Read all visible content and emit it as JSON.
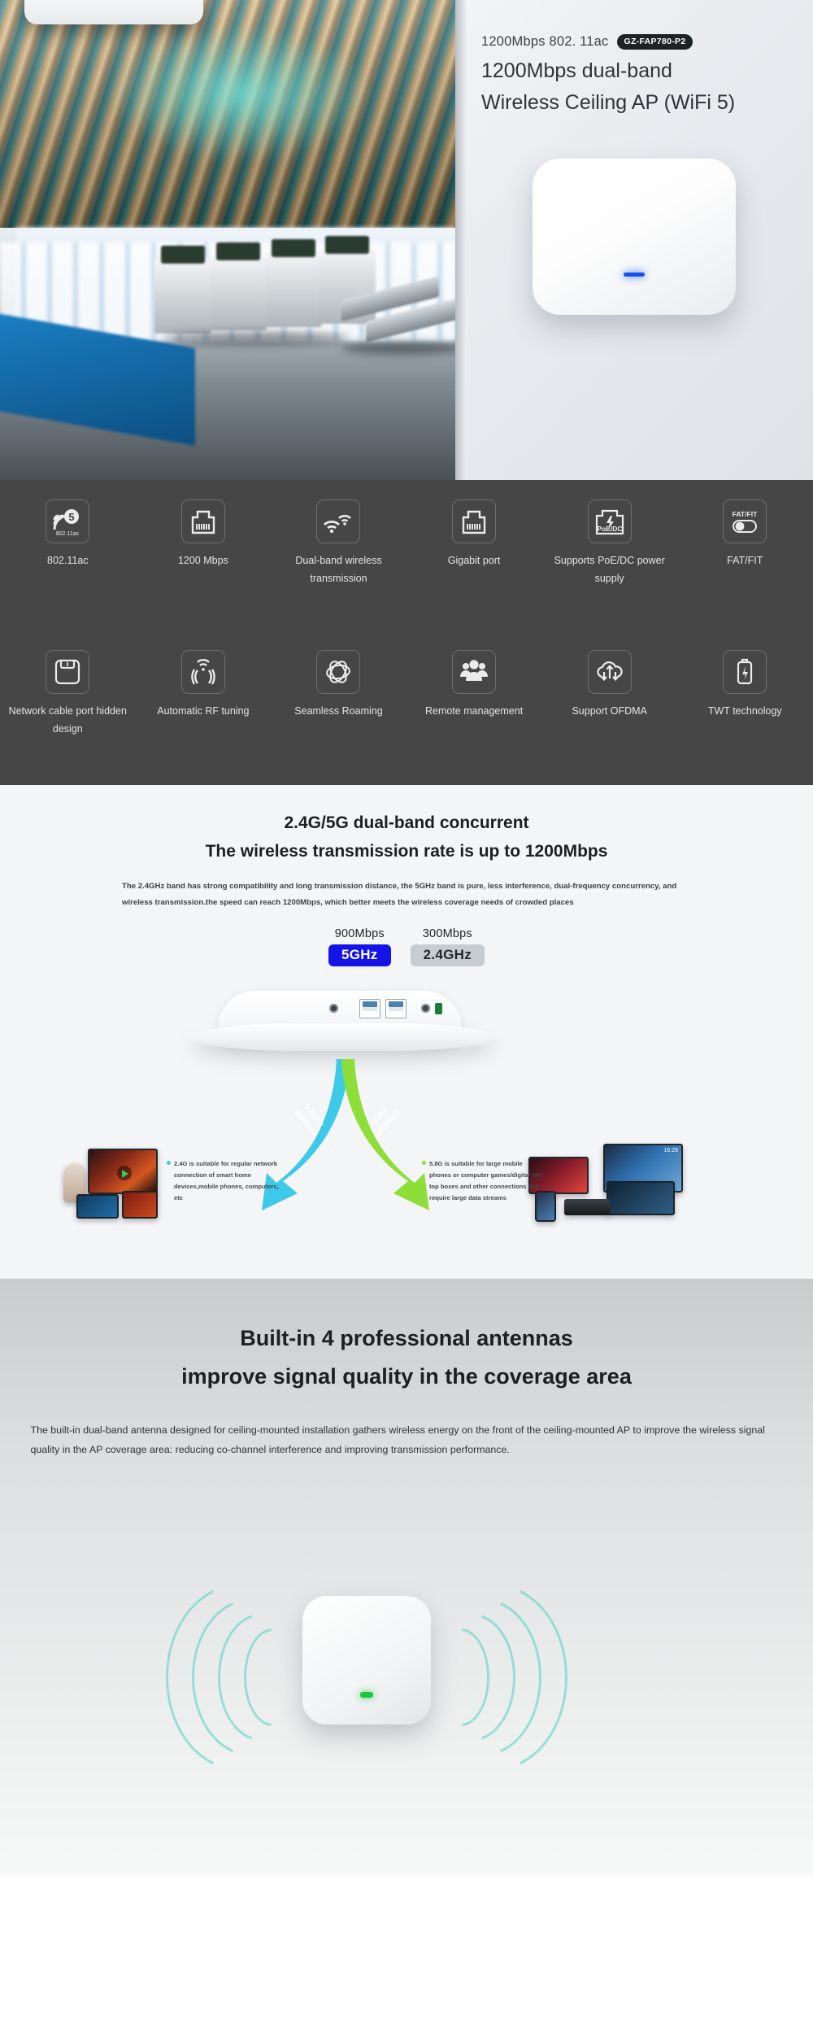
{
  "hero": {
    "kicker": "1200Mbps 802. 11ac",
    "sku": "GZ-FAP780-P2",
    "title_line1": "1200Mbps dual-band",
    "title_line2": "Wireless Ceiling AP (WiFi 5)"
  },
  "features": {
    "row1": [
      {
        "label": "802.11ac",
        "icon": "wifi5-802-11ac-icon",
        "icon_text": "5",
        "icon_sub": "802.11ac"
      },
      {
        "label": "1200 Mbps",
        "icon": "rj45-port-icon"
      },
      {
        "label": "Dual-band wireless transmission",
        "icon": "dual-wifi-icon"
      },
      {
        "label": "Gigabit port",
        "icon": "rj45-port-icon"
      },
      {
        "label": "Supports PoE/DC power supply",
        "icon": "poe-dc-icon",
        "icon_text": "PoE/DC"
      },
      {
        "label": "FAT/FIT",
        "icon": "fat-fit-toggle-icon",
        "icon_text": "FAT/FIT"
      }
    ],
    "row2": [
      {
        "label": "Network cable port hidden design",
        "icon": "hidden-cable-port-icon"
      },
      {
        "label": "Automatic RF tuning",
        "icon": "rf-tuning-icon"
      },
      {
        "label": "Seamless Roaming",
        "icon": "roaming-orbit-icon"
      },
      {
        "label": "Remote management",
        "icon": "users-group-icon"
      },
      {
        "label": "Support OFDMA",
        "icon": "cloud-ofdma-icon"
      },
      {
        "label": "TWT technology",
        "icon": "battery-twt-icon"
      }
    ]
  },
  "dual_band": {
    "heading_line1": "2.4G/5G dual-band concurrent",
    "heading_line2": "The wireless transmission rate is up to 1200Mbps",
    "paragraph": "The 2.4GHz band has strong compatibility and long transmission distance, the 5GHz band is pure, less interference, dual-frequency concurrency, and wireless transmission.the speed can reach 1200Mbps, which better meets the wireless coverage needs of crowded places",
    "badges": [
      {
        "speed": "900Mbps",
        "band": "5GHz",
        "color": "#1414e6"
      },
      {
        "speed": "300Mbps",
        "band": "2.4GHz",
        "color": "#c7ccd1"
      }
    ],
    "arrow_left": {
      "line1": "2.4GHz",
      "line2": "300Mbps",
      "color": "#3ec9e8"
    },
    "arrow_right": {
      "line1": "5GHz",
      "line2": "900Mbps",
      "color": "#8ede3a"
    },
    "caption_left": "2.4G is suitable for regular network connection of smart home devices,mobile phones, computers, etc",
    "caption_right": "5.8G is suitable for large mobile phones or computer games/digital set-top boxes and other connections that require large data streams"
  },
  "antenna": {
    "heading_line1": "Built-in 4 professional antennas",
    "heading_line2": "improve signal quality in the coverage area",
    "paragraph": "The built-in dual-band antenna designed for ceiling-mounted installation gathers wireless energy on the front of the ceiling-mounted AP to improve the wireless signal quality in the AP coverage area: reducing co-channel interference and improving transmission performance."
  }
}
